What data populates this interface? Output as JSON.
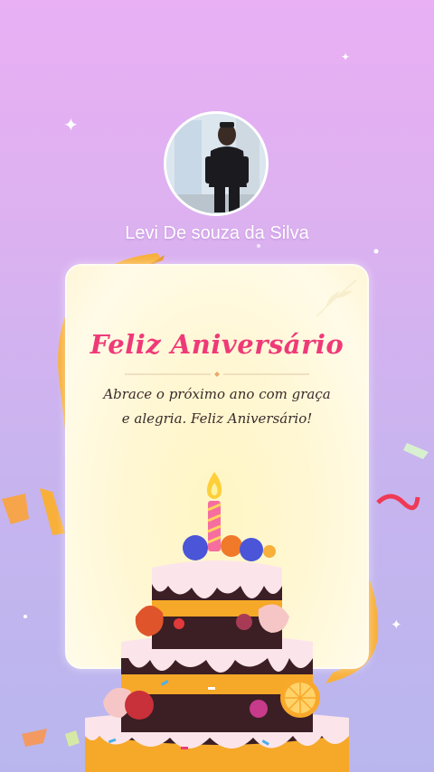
{
  "profile": {
    "name": "Levi De souza da Silva",
    "avatar_icon": "person-photo"
  },
  "card": {
    "title": "Feliz Aniversário",
    "message": "Abrace o próximo ano com graça e alegria. Feliz Aniversário!"
  },
  "colors": {
    "title": "#ef3a78",
    "background_top": "#e9b0f4",
    "background_bottom": "#b9b6ee",
    "ribbon": "#f8b03a"
  }
}
